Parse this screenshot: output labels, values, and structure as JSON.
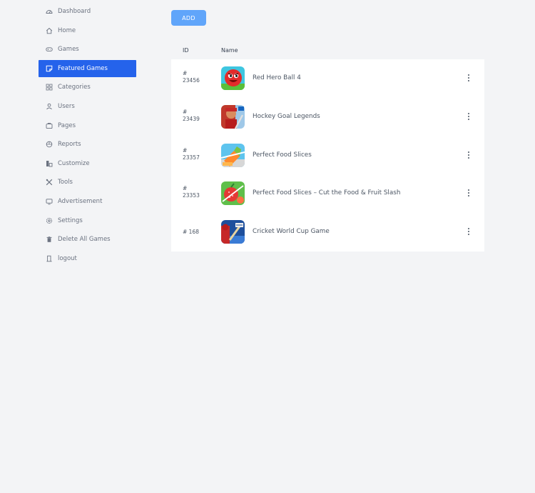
{
  "sidebar": {
    "items": [
      {
        "label": "Dashboard",
        "icon": "dashboard-icon"
      },
      {
        "label": "Home",
        "icon": "home-icon"
      },
      {
        "label": "Games",
        "icon": "gamepad-icon"
      },
      {
        "label": "Featured Games",
        "icon": "featured-icon",
        "active": true
      },
      {
        "label": "Categories",
        "icon": "categories-icon"
      },
      {
        "label": "Users",
        "icon": "user-icon"
      },
      {
        "label": "Pages",
        "icon": "pages-icon"
      },
      {
        "label": "Reports",
        "icon": "reports-icon"
      },
      {
        "label": "Customize",
        "icon": "customize-icon"
      },
      {
        "label": "Tools",
        "icon": "tools-icon"
      },
      {
        "label": "Advertisement",
        "icon": "monitor-icon"
      },
      {
        "label": "Settings",
        "icon": "gear-icon"
      },
      {
        "label": "Delete All Games",
        "icon": "trash-icon"
      },
      {
        "label": "logout",
        "icon": "logout-icon"
      }
    ]
  },
  "toolbar": {
    "add_label": "ADD"
  },
  "table": {
    "columns": {
      "id": "ID",
      "name": "Name"
    },
    "rows": [
      {
        "id_prefix": "#",
        "id_value": "23456",
        "name": "Red Hero Ball 4",
        "thumb_icon": "red-ball-game-thumbnail"
      },
      {
        "id_prefix": "#",
        "id_value": "23439",
        "name": "Hockey Goal Legends",
        "thumb_icon": "hockey-game-thumbnail"
      },
      {
        "id_prefix": "#",
        "id_value": "23357",
        "name": "Perfect Food Slices",
        "thumb_icon": "food-slice-game-thumbnail"
      },
      {
        "id_prefix": "#",
        "id_value": "23353",
        "name": "Perfect Food Slices – Cut the Food & Fruit Slash",
        "thumb_icon": "fruit-slash-game-thumbnail"
      },
      {
        "id_full": "# 168",
        "name": "Cricket World Cup Game",
        "thumb_icon": "cricket-game-thumbnail"
      }
    ]
  },
  "colors": {
    "accent": "#2563eb",
    "add_button": "#60a5fa",
    "background": "#f3f4f6"
  }
}
